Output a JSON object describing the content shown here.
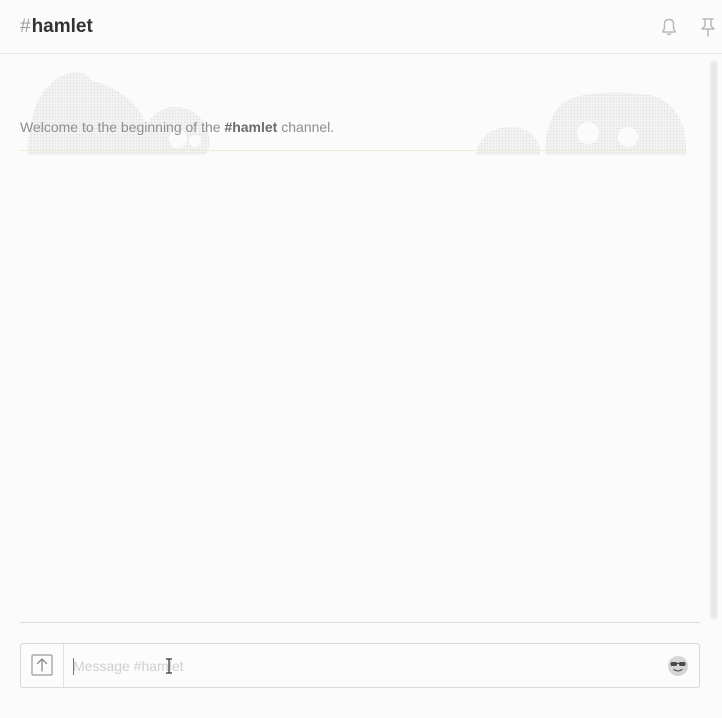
{
  "header": {
    "hash": "#",
    "channel_name": "hamlet",
    "icons": [
      "bell-icon",
      "pin-icon"
    ]
  },
  "messages": {
    "welcome_prefix": "Welcome to the beginning of the ",
    "welcome_channel": "#hamlet",
    "welcome_suffix": " channel."
  },
  "composer": {
    "placeholder": "Message #hamlet",
    "value": "",
    "icons": [
      "upload-icon",
      "emoji-icon"
    ]
  },
  "colors": {
    "background": "#fbfbfb",
    "title": "#333333",
    "muted_text": "#8e8e8e",
    "border": "#d9d9d9"
  }
}
